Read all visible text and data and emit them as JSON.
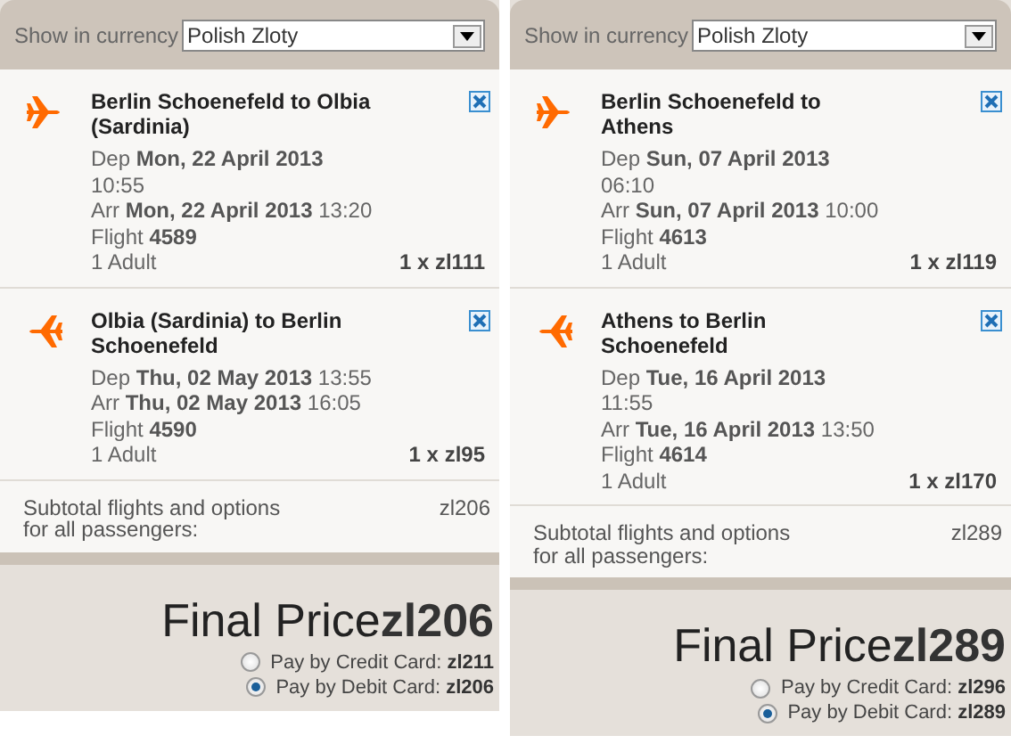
{
  "panels": [
    {
      "currency": {
        "label": "Show in currency",
        "value": "Polish Zloty"
      },
      "flights": [
        {
          "kind": "outbound",
          "title": "Berlin Schoenefeld to Olbia\n(Sardinia)",
          "dep": "Dep **Mon, 22 April 2013**\n10:55",
          "arr": "Arr **Mon, 22 April 2013** 13:20",
          "flight": "Flight **4589**",
          "passengers": "1 Adult",
          "price": "1 x zl111"
        },
        {
          "kind": "return",
          "title": "Olbia (Sardinia) to Berlin\nSchoenefeld",
          "dep": "Dep **Thu, 02 May 2013** 13:55",
          "arr": "Arr **Thu, 02 May 2013** 16:05",
          "flight": "Flight **4590**",
          "passengers": "1 Adult",
          "price": "1 x zl95"
        }
      ],
      "subtotal": {
        "label": "Subtotal flights and options\nfor all passengers:",
        "value": "zl206"
      },
      "final": {
        "label": "Final Price",
        "value": "zl206"
      },
      "payments": [
        {
          "label": "Pay by Credit Card:",
          "amount": "zl211",
          "selected": false
        },
        {
          "label": "Pay by Debit Card:",
          "amount": "zl206",
          "selected": true
        }
      ]
    },
    {
      "currency": {
        "label": "Show in currency",
        "value": "Polish Zloty"
      },
      "flights": [
        {
          "kind": "outbound",
          "title": "Berlin Schoenefeld to\nAthens",
          "dep": "Dep **Sun, 07 April 2013**\n06:10",
          "arr": "Arr **Sun, 07 April 2013** 10:00",
          "flight": "Flight **4613**",
          "passengers": "1 Adult",
          "price": "1 x zl119"
        },
        {
          "kind": "return",
          "title": "Athens to Berlin\nSchoenefeld",
          "dep": "Dep **Tue, 16 April 2013**\n11:55",
          "arr": "Arr **Tue, 16 April 2013** 13:50",
          "flight": "Flight **4614**",
          "passengers": "1 Adult",
          "price": "1 x zl170"
        }
      ],
      "subtotal": {
        "label": "Subtotal flights and options\nfor all passengers:",
        "value": "zl289"
      },
      "final": {
        "label": "Final Price",
        "value": "zl289"
      },
      "payments": [
        {
          "label": "Pay by Credit Card:",
          "amount": "zl296",
          "selected": false
        },
        {
          "label": "Pay by Debit Card:",
          "amount": "zl289",
          "selected": true
        }
      ]
    }
  ]
}
